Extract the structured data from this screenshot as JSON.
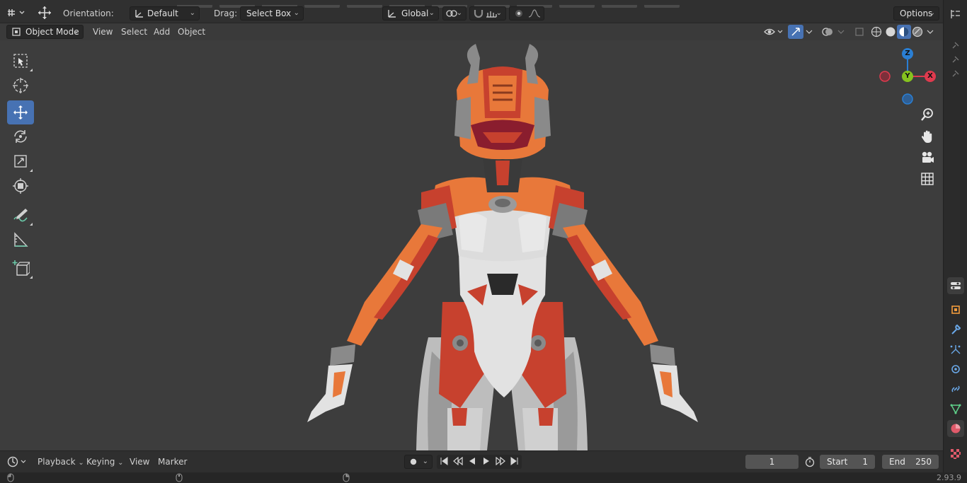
{
  "top_header": {
    "orientation_label": "Orientation:",
    "orientation_value": "Default",
    "drag_label": "Drag:",
    "drag_value": "Select Box",
    "transform_space": "Global",
    "options_label": "Options"
  },
  "view_header": {
    "mode": "Object Mode",
    "menus": [
      "View",
      "Select",
      "Add",
      "Object"
    ]
  },
  "gizmo": {
    "axes": [
      "Z",
      "Y",
      "X"
    ],
    "colors": {
      "x": "#e03a4e",
      "y": "#86c31f",
      "z": "#2a7fd4"
    }
  },
  "tools": [
    {
      "icon": "select-box-icon",
      "active": false
    },
    {
      "icon": "cursor-icon",
      "active": false
    },
    {
      "icon": "move-icon",
      "active": true
    },
    {
      "icon": "rotate-icon",
      "active": false
    },
    {
      "icon": "scale-icon",
      "active": false
    },
    {
      "icon": "transform-icon",
      "active": false
    },
    {
      "icon": "annotate-icon",
      "active": false
    },
    {
      "icon": "measure-icon",
      "active": false
    },
    {
      "icon": "add-cube-icon",
      "active": false
    }
  ],
  "timeline": {
    "menus": [
      "Playback",
      "Keying",
      "View",
      "Marker"
    ],
    "current_frame": "1",
    "start_label": "Start",
    "start_value": "1",
    "end_label": "End",
    "end_value": "250"
  },
  "status": {
    "version": "2.93.9"
  },
  "colors": {
    "accent": "#4772b3",
    "suit_orange": "#e8783a",
    "suit_red": "#c7412e",
    "suit_white": "#dcdcdc",
    "suit_grey": "#8c8c8c"
  }
}
